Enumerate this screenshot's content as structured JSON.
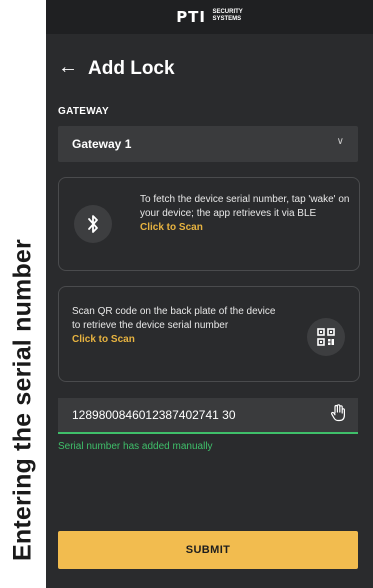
{
  "caption": "Entering the serial number",
  "header": {
    "logo": "PTI",
    "logo_sub_1": "SECURITY",
    "logo_sub_2": "SYSTEMS"
  },
  "page": {
    "back_glyph": "←",
    "title": "Add Lock"
  },
  "gateway": {
    "label": "GATEWAY",
    "selected": "Gateway 1",
    "chevron": "∨"
  },
  "ble_card": {
    "icon": "bluetooth-icon",
    "text": "To fetch the device serial number, tap 'wake' on your device; the app retrieves it via BLE",
    "link": "Click to Scan"
  },
  "qr_card": {
    "icon": "qr-code-icon",
    "text": "Scan QR code on the back plate of the device to retrieve the device serial number",
    "link": "Click to Scan"
  },
  "serial": {
    "value": "1289800846012387402741 30",
    "icon": "hand-pointer-icon",
    "helper": "Serial number has added manually"
  },
  "submit": {
    "label": "SUBMIT"
  },
  "colors": {
    "background": "#2a2b2d",
    "accent": "#f2bc4f",
    "success": "#3fbf6a",
    "link": "#e7b340"
  }
}
